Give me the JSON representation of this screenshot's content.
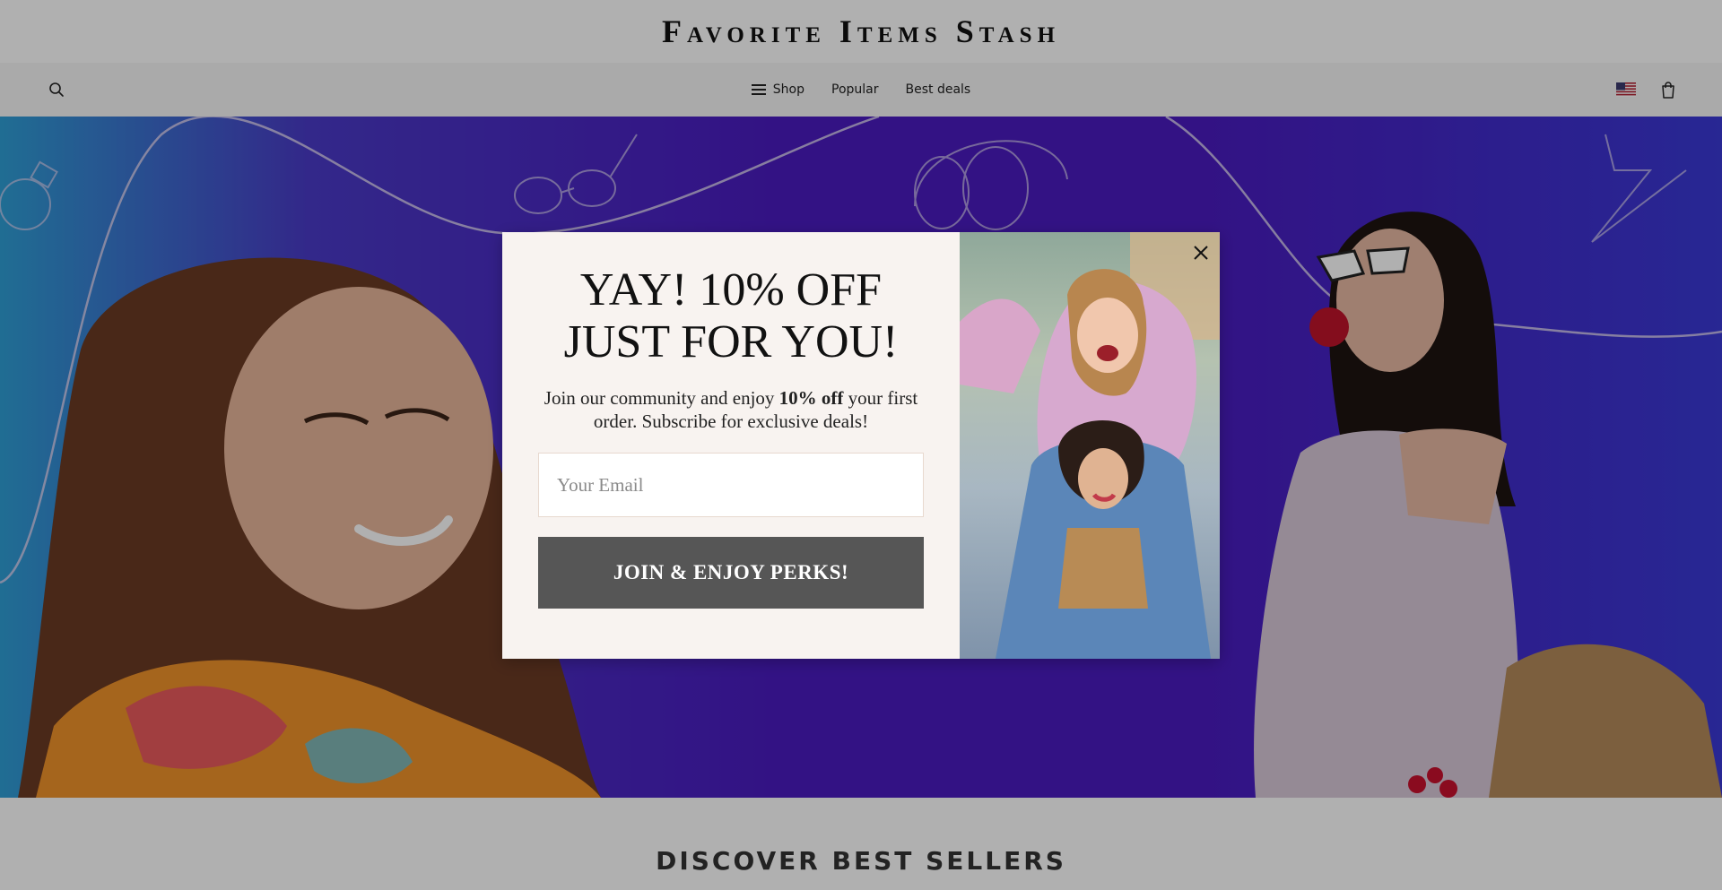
{
  "brand": {
    "title": "Favorite Items Stash"
  },
  "nav": {
    "search_icon": "search-icon",
    "links": [
      {
        "label": "Shop",
        "icon": "menu-icon"
      },
      {
        "label": "Popular"
      },
      {
        "label": "Best deals"
      }
    ],
    "flag_icon": "us-flag-icon",
    "cart_icon": "shopping-bag-icon"
  },
  "hero": {
    "colors": {
      "left": "#2f9fd6",
      "center": "#4a1bc0",
      "right": "#3a39d6"
    }
  },
  "section": {
    "title": "DISCOVER BEST SELLERS"
  },
  "modal": {
    "headline_line1": "YAY! 10% OFF",
    "headline_line2": "JUST FOR YOU!",
    "body_prefix": "Join our community and enjoy ",
    "body_bold": "10% off",
    "body_suffix": " your first order. Subscribe for exclusive deals!",
    "email_placeholder": "Your Email",
    "email_value": "",
    "submit_label": "JOIN & ENJOY PERKS!",
    "close_icon": "close-icon",
    "colors": {
      "panel": "#f8f3f0",
      "button": "#565656"
    }
  }
}
